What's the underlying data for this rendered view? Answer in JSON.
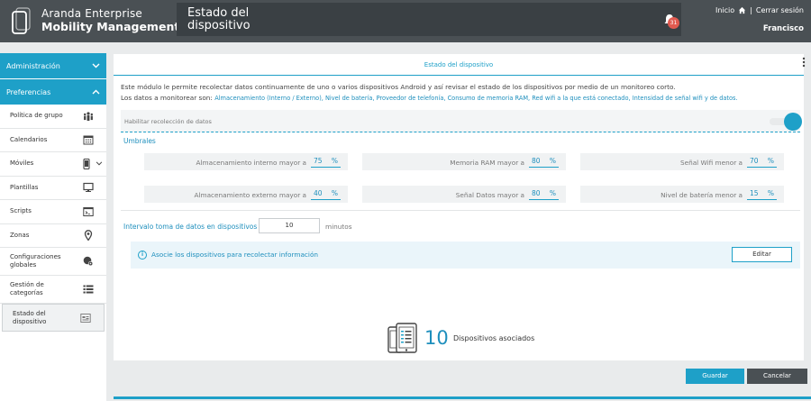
{
  "header": {
    "brand_line1": "Aranda Enterprise",
    "brand_line2": "Mobility Management",
    "page_title_line1": "Estado del",
    "page_title_line2": "dispositivo",
    "notification_count": "31",
    "home_link": "Inicio",
    "logout_link": "Cerrar sesión",
    "separator": "|",
    "user_name": "Francisco"
  },
  "sidebar": {
    "sections": [
      {
        "label": "Administración"
      },
      {
        "label": "Preferencias"
      }
    ],
    "items": [
      {
        "label": "Política de grupo",
        "icon": "group-icon"
      },
      {
        "label": "Calendarios",
        "icon": "calendar-icon"
      },
      {
        "label": "Móviles",
        "icon": "mobile-icon"
      },
      {
        "label": "Plantillas",
        "icon": "monitor-icon"
      },
      {
        "label": "Scripts",
        "icon": "terminal-icon"
      },
      {
        "label": "Zonas",
        "icon": "location-pin-icon"
      },
      {
        "label": "Configuraciones globales",
        "icon": "global-settings-icon"
      },
      {
        "label": "Gestión de categorías",
        "icon": "list-icon"
      },
      {
        "label": "Estado del dispositivo",
        "icon": "device-status-icon"
      }
    ]
  },
  "content": {
    "card_title": "Estado del dispositivo",
    "description_1": "Este módulo le permite recolectar datos continuamente de uno o varios dispositivos Android y así revisar el estado de los dispositivos por medio de un monitoreo corto.",
    "description_2_prefix": "Los datos a monitorear son: ",
    "description_2_items": "Almacenamiento (Interno / Externo), Nivel de batería, Proveedor de telefonía, Consumo de memoria RAM, Red wifi a la que está conectado, Intensidad de señal wifi y de datos.",
    "enable_label": "Habilitar recolección de datos",
    "enable_on": true,
    "thresholds_title": "Umbrales",
    "thresholds": [
      {
        "label": "Almacenamiento interno mayor a",
        "value": "75",
        "unit": "%"
      },
      {
        "label": "Memoria RAM mayor a",
        "value": "80",
        "unit": "%"
      },
      {
        "label": "Señal Wifi menor a",
        "value": "70",
        "unit": "%"
      },
      {
        "label": "Almacenamiento externo mayor a",
        "value": "40",
        "unit": "%"
      },
      {
        "label": "Señal Datos mayor a",
        "value": "80",
        "unit": "%"
      },
      {
        "label": "Nivel de batería menor a",
        "value": "15",
        "unit": "%"
      }
    ],
    "interval_label": "Intervalo toma de datos en dispositivos",
    "interval_value": "10",
    "interval_unit": "minutos",
    "info_text": "Asocie los dispositivos para recolectar información",
    "edit_label": "Editar",
    "device_count": "10",
    "device_label": "Dispositivos asociados"
  },
  "footer": {
    "save_label": "Guardar",
    "cancel_label": "Cancelar"
  },
  "colors": {
    "accent": "#1ea0c8",
    "header": "#4a5054",
    "badge": "#e05a50"
  }
}
